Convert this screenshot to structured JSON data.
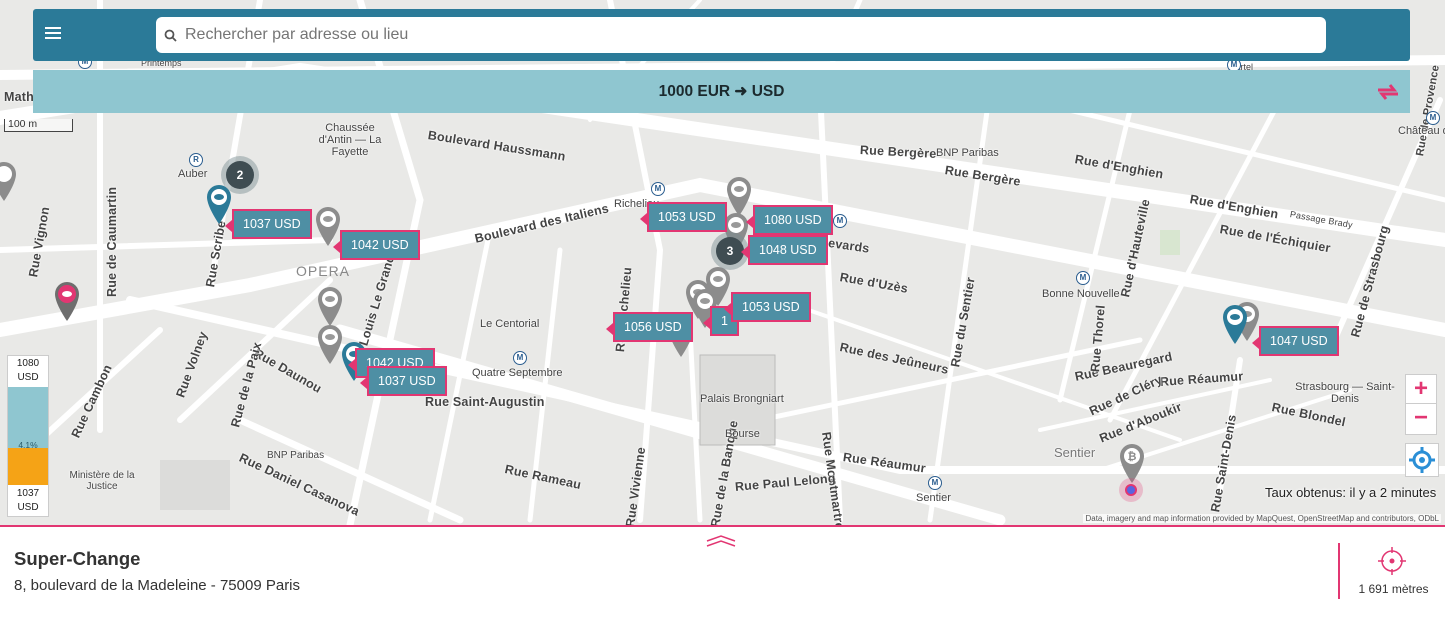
{
  "header": {
    "search_placeholder": "Rechercher par adresse ou lieu"
  },
  "conversion": {
    "label": "1000 EUR ➜  USD"
  },
  "map": {
    "scale": "100 m",
    "district": "OPERA",
    "streets": [
      "Boulevard Haussmann",
      "Boulevard des Italiens",
      "Rue de Caumartin",
      "Rue Vignon",
      "Rue Scribe",
      "Rue Bergère",
      "Rue Bergère",
      "Rue d'Enghien",
      "Rue d'Enghien",
      "Rue de l'Échiquier",
      "Rue d'Hauteville",
      "Rue d'Uzès",
      "Rue des Jeûneurs",
      "Rue du Sentier",
      "Rue Montmartre",
      "Rue Réaumur",
      "Rue Réaumur",
      "Rue Paul Lelong",
      "Rue Rameau",
      "Rue Saint-Augustin",
      "Rue Daunou",
      "Rue Daniel Casanova",
      "Rue de la Paix",
      "Rue Volney",
      "Rue Cambon",
      "Rue Louis Le Grand",
      "Rue Richelieu",
      "Rue Vivienne",
      "Rue de la Banque",
      "Rue Beauregard",
      "Rue de Cléry",
      "Rue d'Aboukir",
      "Rue Blondel",
      "Rue de Strasbourg",
      "Boulevards",
      "Rue Thorel",
      "Rue de Provence",
      "Rue Saint-Denis",
      "Mathurins",
      "Passage Brady"
    ],
    "places": [
      "Chaussée d'Antin — La Fayette",
      "BNP Paribas",
      "Auber",
      "Richelieu",
      "Bonne Nouvelle",
      "Le Centorial",
      "Quatre Septembre",
      "Palais Brongniart",
      "Bourse",
      "Ministère de la Justice",
      "BNP Paribas",
      "Sentier",
      "Sentier",
      "Strasbourg — Saint-Denis",
      "Printemps",
      "Martel",
      "Château d"
    ],
    "clusters": [
      "2",
      "3"
    ],
    "prices": [
      "1037 USD",
      "1042 USD",
      "1053 USD",
      "1080 USD",
      "1048 USD",
      "1053 USD",
      "1056 USD",
      "1047 USD",
      "1042 USD",
      "1037 USD"
    ],
    "gauge": {
      "max": "1080",
      "max_unit": "USD",
      "min": "1037",
      "min_unit": "USD",
      "percent": "4.1%",
      "fill_fraction": 0.38
    },
    "zoom_in": "+",
    "zoom_out": "−",
    "rate_time": "Taux obtenus: il y a 2 minutes",
    "attribution": "Data, imagery and map information provided by MapQuest, OpenStreetMap and contributors, ODbL"
  },
  "panel": {
    "name": "Super-Change",
    "address": "8, boulevard de la Madeleine - 75009 Paris",
    "distance": "1 691 mètres"
  },
  "colors": {
    "header": "#2b7a98",
    "conversion_bar": "#8fc6d0",
    "accent": "#e23672",
    "price_bg": "#4e8fa4",
    "gauge_fill": "#f5a316"
  }
}
